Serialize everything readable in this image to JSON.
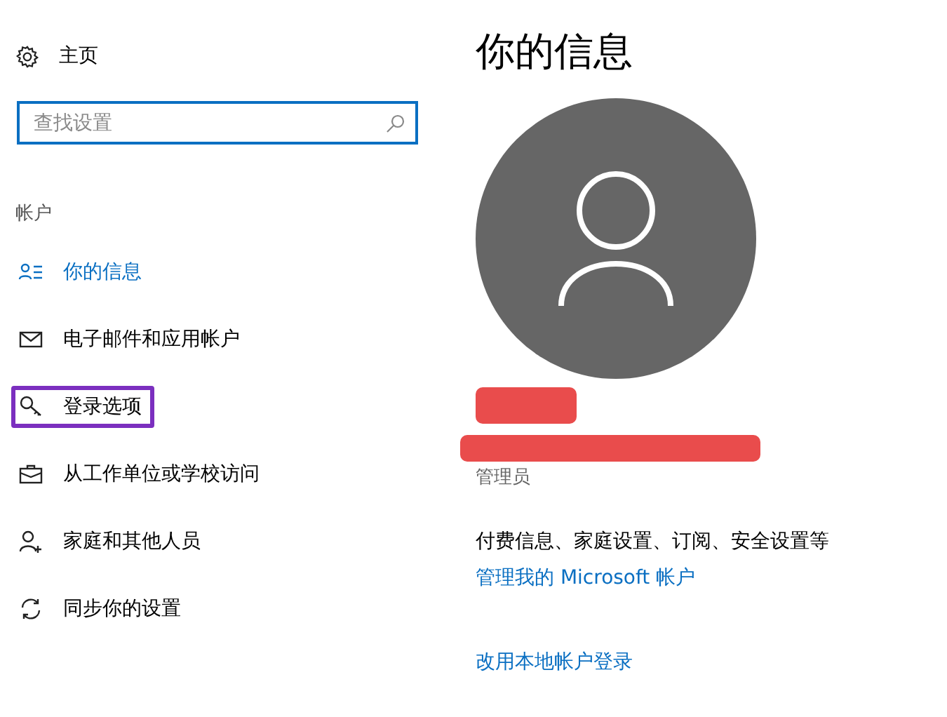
{
  "sidebar": {
    "home": {
      "label": "主页"
    },
    "search": {
      "placeholder": "查找设置"
    },
    "section": "帐户",
    "items": [
      {
        "label": "你的信息",
        "kind": "info",
        "selected": true,
        "highlighted": false
      },
      {
        "label": "电子邮件和应用帐户",
        "kind": "mail",
        "selected": false,
        "highlighted": false
      },
      {
        "label": "登录选项",
        "kind": "key",
        "selected": false,
        "highlighted": true
      },
      {
        "label": "从工作单位或学校访问",
        "kind": "briefcase",
        "selected": false,
        "highlighted": false
      },
      {
        "label": "家庭和其他人员",
        "kind": "person-add",
        "selected": false,
        "highlighted": false
      },
      {
        "label": "同步你的设置",
        "kind": "sync",
        "selected": false,
        "highlighted": false
      }
    ]
  },
  "main": {
    "title": "你的信息",
    "redaction_bars": [
      {
        "kind": "short"
      },
      {
        "kind": "long"
      }
    ],
    "role": "管理员",
    "description": "付费信息、家庭设置、订阅、安全设置等",
    "links": [
      {
        "label": "管理我的 Microsoft 帐户"
      },
      {
        "label": "改用本地帐户登录"
      }
    ]
  }
}
